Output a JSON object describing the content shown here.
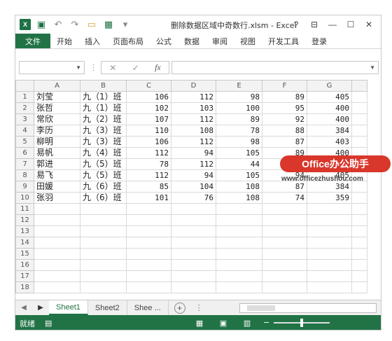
{
  "titlebar": {
    "title": "删除数据区域中奇数行.xlsm - Excel",
    "help": "?",
    "ribbon_display": "⊟",
    "minimize": "—",
    "restore": "☐",
    "close": "✕"
  },
  "ribbon": {
    "file": "文件",
    "tabs": [
      "开始",
      "插入",
      "页面布局",
      "公式",
      "数据",
      "审阅",
      "视图",
      "开发工具",
      "登录"
    ]
  },
  "formula_bar": {
    "namebox": "",
    "cancel": "✕",
    "enter": "✓",
    "fx": "fx",
    "content": ""
  },
  "grid": {
    "columns": [
      "A",
      "B",
      "C",
      "D",
      "E",
      "F",
      "G"
    ],
    "row_numbers": [
      "1",
      "2",
      "3",
      "4",
      "5",
      "6",
      "7",
      "8",
      "9",
      "10",
      "11",
      "12",
      "13",
      "14",
      "15",
      "16",
      "17",
      "18"
    ],
    "rows": [
      [
        "刘莹",
        "九（1）班",
        "106",
        "112",
        "98",
        "89",
        "405"
      ],
      [
        "张哲",
        "九（1）班",
        "102",
        "103",
        "100",
        "95",
        "400"
      ],
      [
        "常欣",
        "九（2）班",
        "107",
        "112",
        "89",
        "92",
        "400"
      ],
      [
        "李历",
        "九（3）班",
        "110",
        "108",
        "78",
        "88",
        "384"
      ],
      [
        "柳明",
        "九（3）班",
        "106",
        "112",
        "98",
        "87",
        "403"
      ],
      [
        "易帆",
        "九（4）班",
        "112",
        "94",
        "105",
        "89",
        "400"
      ],
      [
        "郭进",
        "九（5）班",
        "78",
        "112",
        "44",
        "",
        ""
      ],
      [
        "易飞",
        "九（5）班",
        "112",
        "94",
        "105",
        "94",
        "405"
      ],
      [
        "田媛",
        "九（6）班",
        "85",
        "104",
        "108",
        "87",
        "384"
      ],
      [
        "张羽",
        "九（6）班",
        "101",
        "76",
        "108",
        "74",
        "359"
      ],
      [
        "",
        "",
        "",
        "",
        "",
        "",
        ""
      ],
      [
        "",
        "",
        "",
        "",
        "",
        "",
        ""
      ],
      [
        "",
        "",
        "",
        "",
        "",
        "",
        ""
      ],
      [
        "",
        "",
        "",
        "",
        "",
        "",
        ""
      ],
      [
        "",
        "",
        "",
        "",
        "",
        "",
        ""
      ],
      [
        "",
        "",
        "",
        "",
        "",
        "",
        ""
      ],
      [
        "",
        "",
        "",
        "",
        "",
        "",
        ""
      ],
      [
        "",
        "",
        "",
        "",
        "",
        "",
        ""
      ]
    ]
  },
  "sheets": {
    "tabs": [
      "Sheet1",
      "Sheet2",
      "Shee ..."
    ],
    "active": 0,
    "add": "+"
  },
  "status": {
    "text": "就绪"
  },
  "watermark": {
    "badge": "Office办公助手",
    "url": "www.officezhushou.com"
  }
}
